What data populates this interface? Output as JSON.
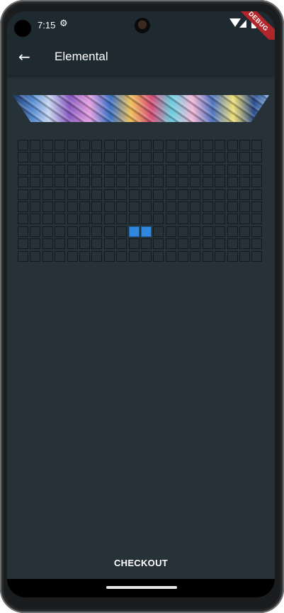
{
  "status_bar": {
    "time": "7:15",
    "settings_icon": "gear-icon",
    "debug_banner": "DEBUG"
  },
  "app_bar": {
    "title": "Elemental",
    "back_icon": "arrow-left-icon"
  },
  "grid": {
    "columns": 20,
    "rows": 10,
    "selected_cells": [
      [
        7,
        9
      ],
      [
        7,
        10
      ]
    ],
    "selected_color": "#2f88de"
  },
  "checkout": {
    "label": "CHECKOUT"
  }
}
